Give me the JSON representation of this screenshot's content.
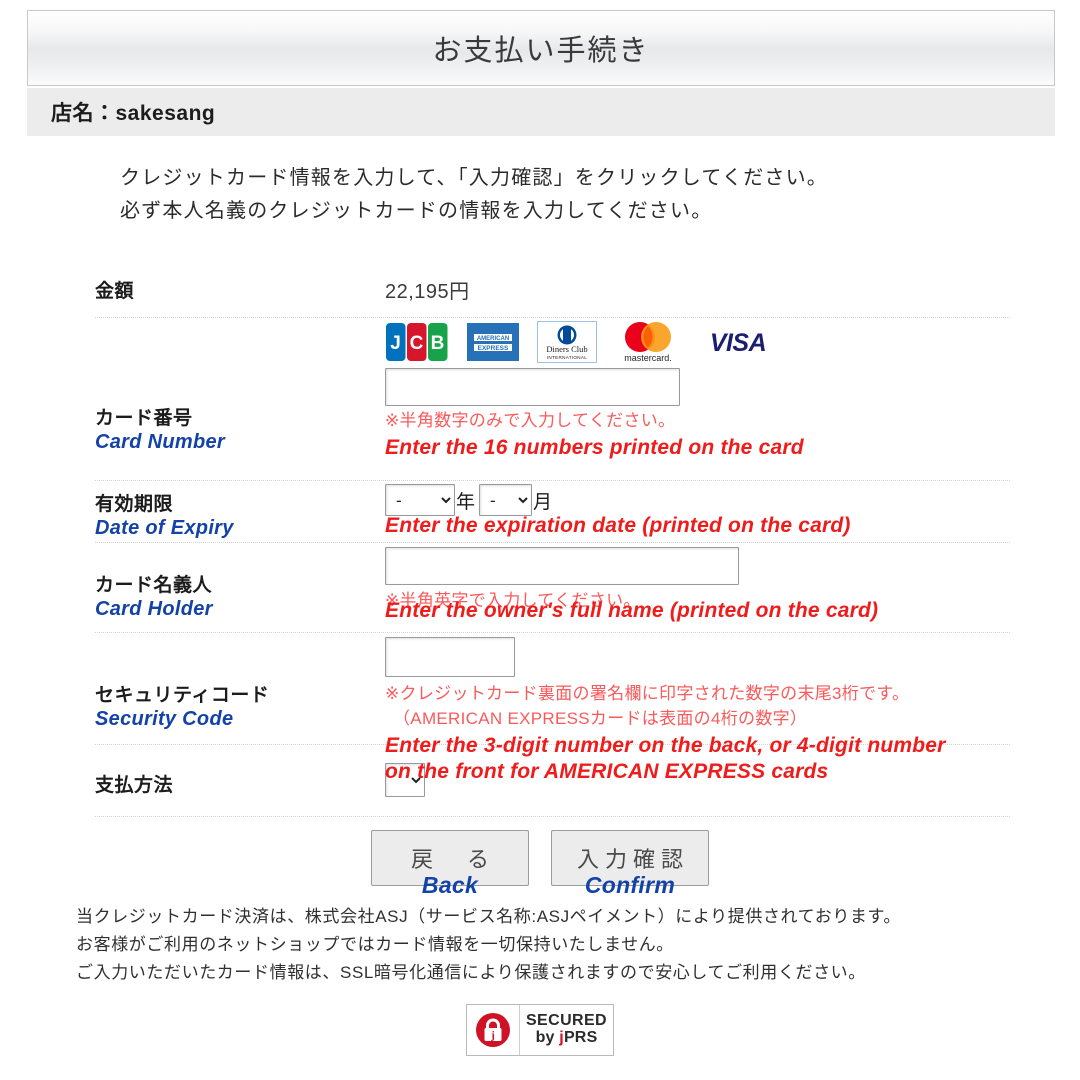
{
  "header": {
    "title": "お支払い手続き",
    "shop_label": "店名：sakesang"
  },
  "intro": {
    "line1": "クレジットカード情報を入力して、「入力確認」をクリックしてください。",
    "line2": "必ず本人名義のクレジットカードの情報を入力してください。"
  },
  "rows": {
    "amount": {
      "label_ja": "金額",
      "value": "22,195円"
    },
    "card_number": {
      "label_ja": "カード番号",
      "label_en": "Card Number",
      "input_value": "",
      "note_ja": "※半角数字のみで入力してください。",
      "note_en": "Enter the 16 numbers printed on the card"
    },
    "expiry": {
      "label_ja": "有効期限",
      "label_en": "Date of Expiry",
      "year_value": "-",
      "year_suffix": "年",
      "month_value": "-",
      "month_suffix": "月",
      "note_en": "Enter the expiration date (printed on the card)",
      "options": [
        "-"
      ]
    },
    "card_holder": {
      "label_ja": "カード名義人",
      "label_en": "Card Holder",
      "input_value": "",
      "note_ja": "※半角英字で入力してください。",
      "note_en": "Enter the owner's full name (printed on the card)"
    },
    "security_code": {
      "label_ja": "セキュリティコード",
      "label_en": "Security Code",
      "input_value": "",
      "note_ja_1": "※クレジットカード裏面の署名欄に印字された数字の末尾3桁です。",
      "note_ja_2": "（AMERICAN EXPRESSカードは表面の4桁の数字）",
      "note_en_1": "Enter the 3-digit number on the back, or 4-digit number",
      "note_en_2": "on the front for AMERICAN EXPRESS cards"
    },
    "payment_method": {
      "label_ja": "支払方法",
      "select_value": "",
      "options": [
        ""
      ]
    }
  },
  "brands": [
    {
      "name": "jcb-logo",
      "alt": "JCB"
    },
    {
      "name": "amex-logo",
      "alt": "AMERICAN EXPRESS"
    },
    {
      "name": "diners-club-logo",
      "alt": "Diners Club INTERNATIONAL"
    },
    {
      "name": "mastercard-logo",
      "alt": "mastercard"
    },
    {
      "name": "visa-logo",
      "alt": "VISA"
    }
  ],
  "buttons": {
    "back_ja": "戻　る",
    "back_en": "Back",
    "confirm_ja": "入力確認",
    "confirm_en": "Confirm"
  },
  "footer": {
    "line1": "当クレジットカード決済は、株式会社ASJ（サービス名称:ASJペイメント）により提供されております。",
    "line2": "お客様がご利用のネットショップではカード情報を一切保持いたしません。",
    "line3": "ご入力いただいたカード情報は、SSL暗号化通信により保護されますので安心してご利用ください。"
  },
  "seal": {
    "line1": "SECURED",
    "by": "by ",
    "j": "j",
    "prs": "PRS",
    "icon": "padlock-icon"
  },
  "colors": {
    "label_en_blue": "#1342a8",
    "note_red": "#f01b1b",
    "jcb_blue": "#0071BC",
    "jcb_red": "#D6172B",
    "jcb_green": "#16A34A",
    "amex_blue": "#2671B8",
    "diners_blue": "#004A97",
    "mastercard_red": "#EB001B",
    "mastercard_orange": "#F79E1B",
    "visa_navy": "#1A1F71",
    "jprs_red": "#CF1225"
  }
}
